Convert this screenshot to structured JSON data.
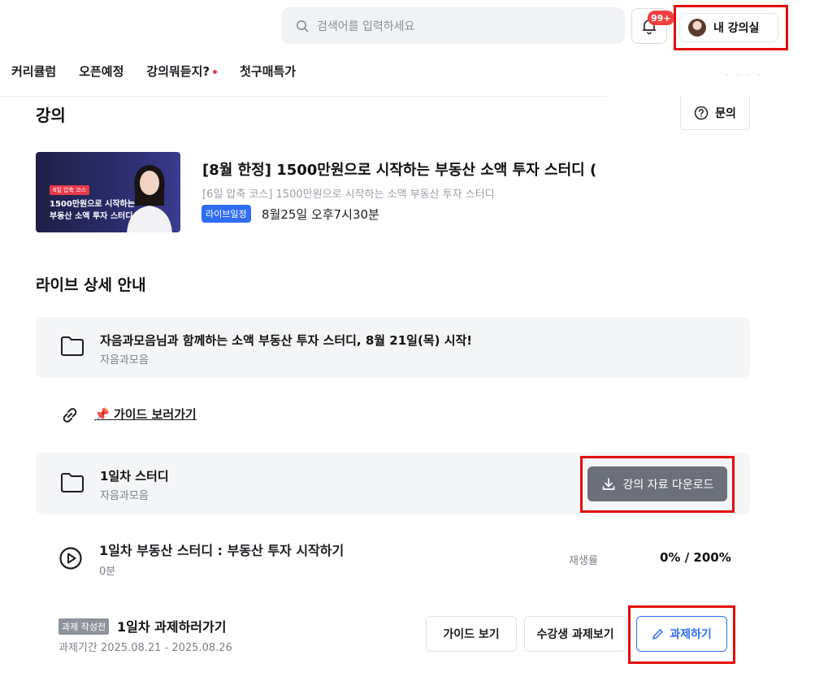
{
  "header": {
    "search_placeholder": "검색어를 입력하세요",
    "notification_badge": "99+",
    "my_classroom_label": "내 강의실"
  },
  "nav": {
    "items": [
      "커리큘럼",
      "오픈예정",
      "강의뭐듣지?",
      "첫구매특가"
    ],
    "faint_text": "· · ·  ·"
  },
  "page": {
    "title": "강의",
    "inquiry_label": "문의"
  },
  "course": {
    "title": "[8월 한정] 1500만원으로 시작하는 부동산 소액 투자 스터디 (",
    "subtitle": "[6일 압축 코스] 1500만원으로 시작하는 소액 부동산 투자 스터디",
    "live_tag": "라이브일정",
    "live_date": "8월25일 오후7시30분",
    "thumbnail": {
      "tag": "6일 압축 코스",
      "line1": "1500만원으로 시작하는",
      "line2": "부동산 소액 투자 스터디"
    }
  },
  "live_section": {
    "title": "라이브 상세 안내",
    "notice": {
      "title": "자음과모음님과 함께하는 소액 부동산 투자 스터디, 8월 21일(목) 시작!",
      "author": "자음과모음"
    },
    "guide_link": "📌 가이드 보러가기",
    "day1": {
      "title": "1일차 스터디",
      "author": "자음과모음",
      "download_label": "강의 자료 다운로드"
    },
    "lesson": {
      "title": "1일차 부동산 스터디 : 부동산 투자 시작하기",
      "duration": "0분",
      "play_rate_label": "재생률",
      "play_rate_value": "0% / 200%"
    },
    "assignment": {
      "tag": "과제 작성전",
      "title": "1일차 과제하러가기",
      "period": "과제기간 2025.08.21 - 2025.08.26",
      "guide_button": "가이드 보기",
      "students_button": "수강생 과제보기",
      "write_button": "과제하기"
    }
  },
  "colors": {
    "accent_blue": "#2f6df6",
    "highlight_red": "#e30d0d",
    "badge_red": "#f0403f"
  }
}
